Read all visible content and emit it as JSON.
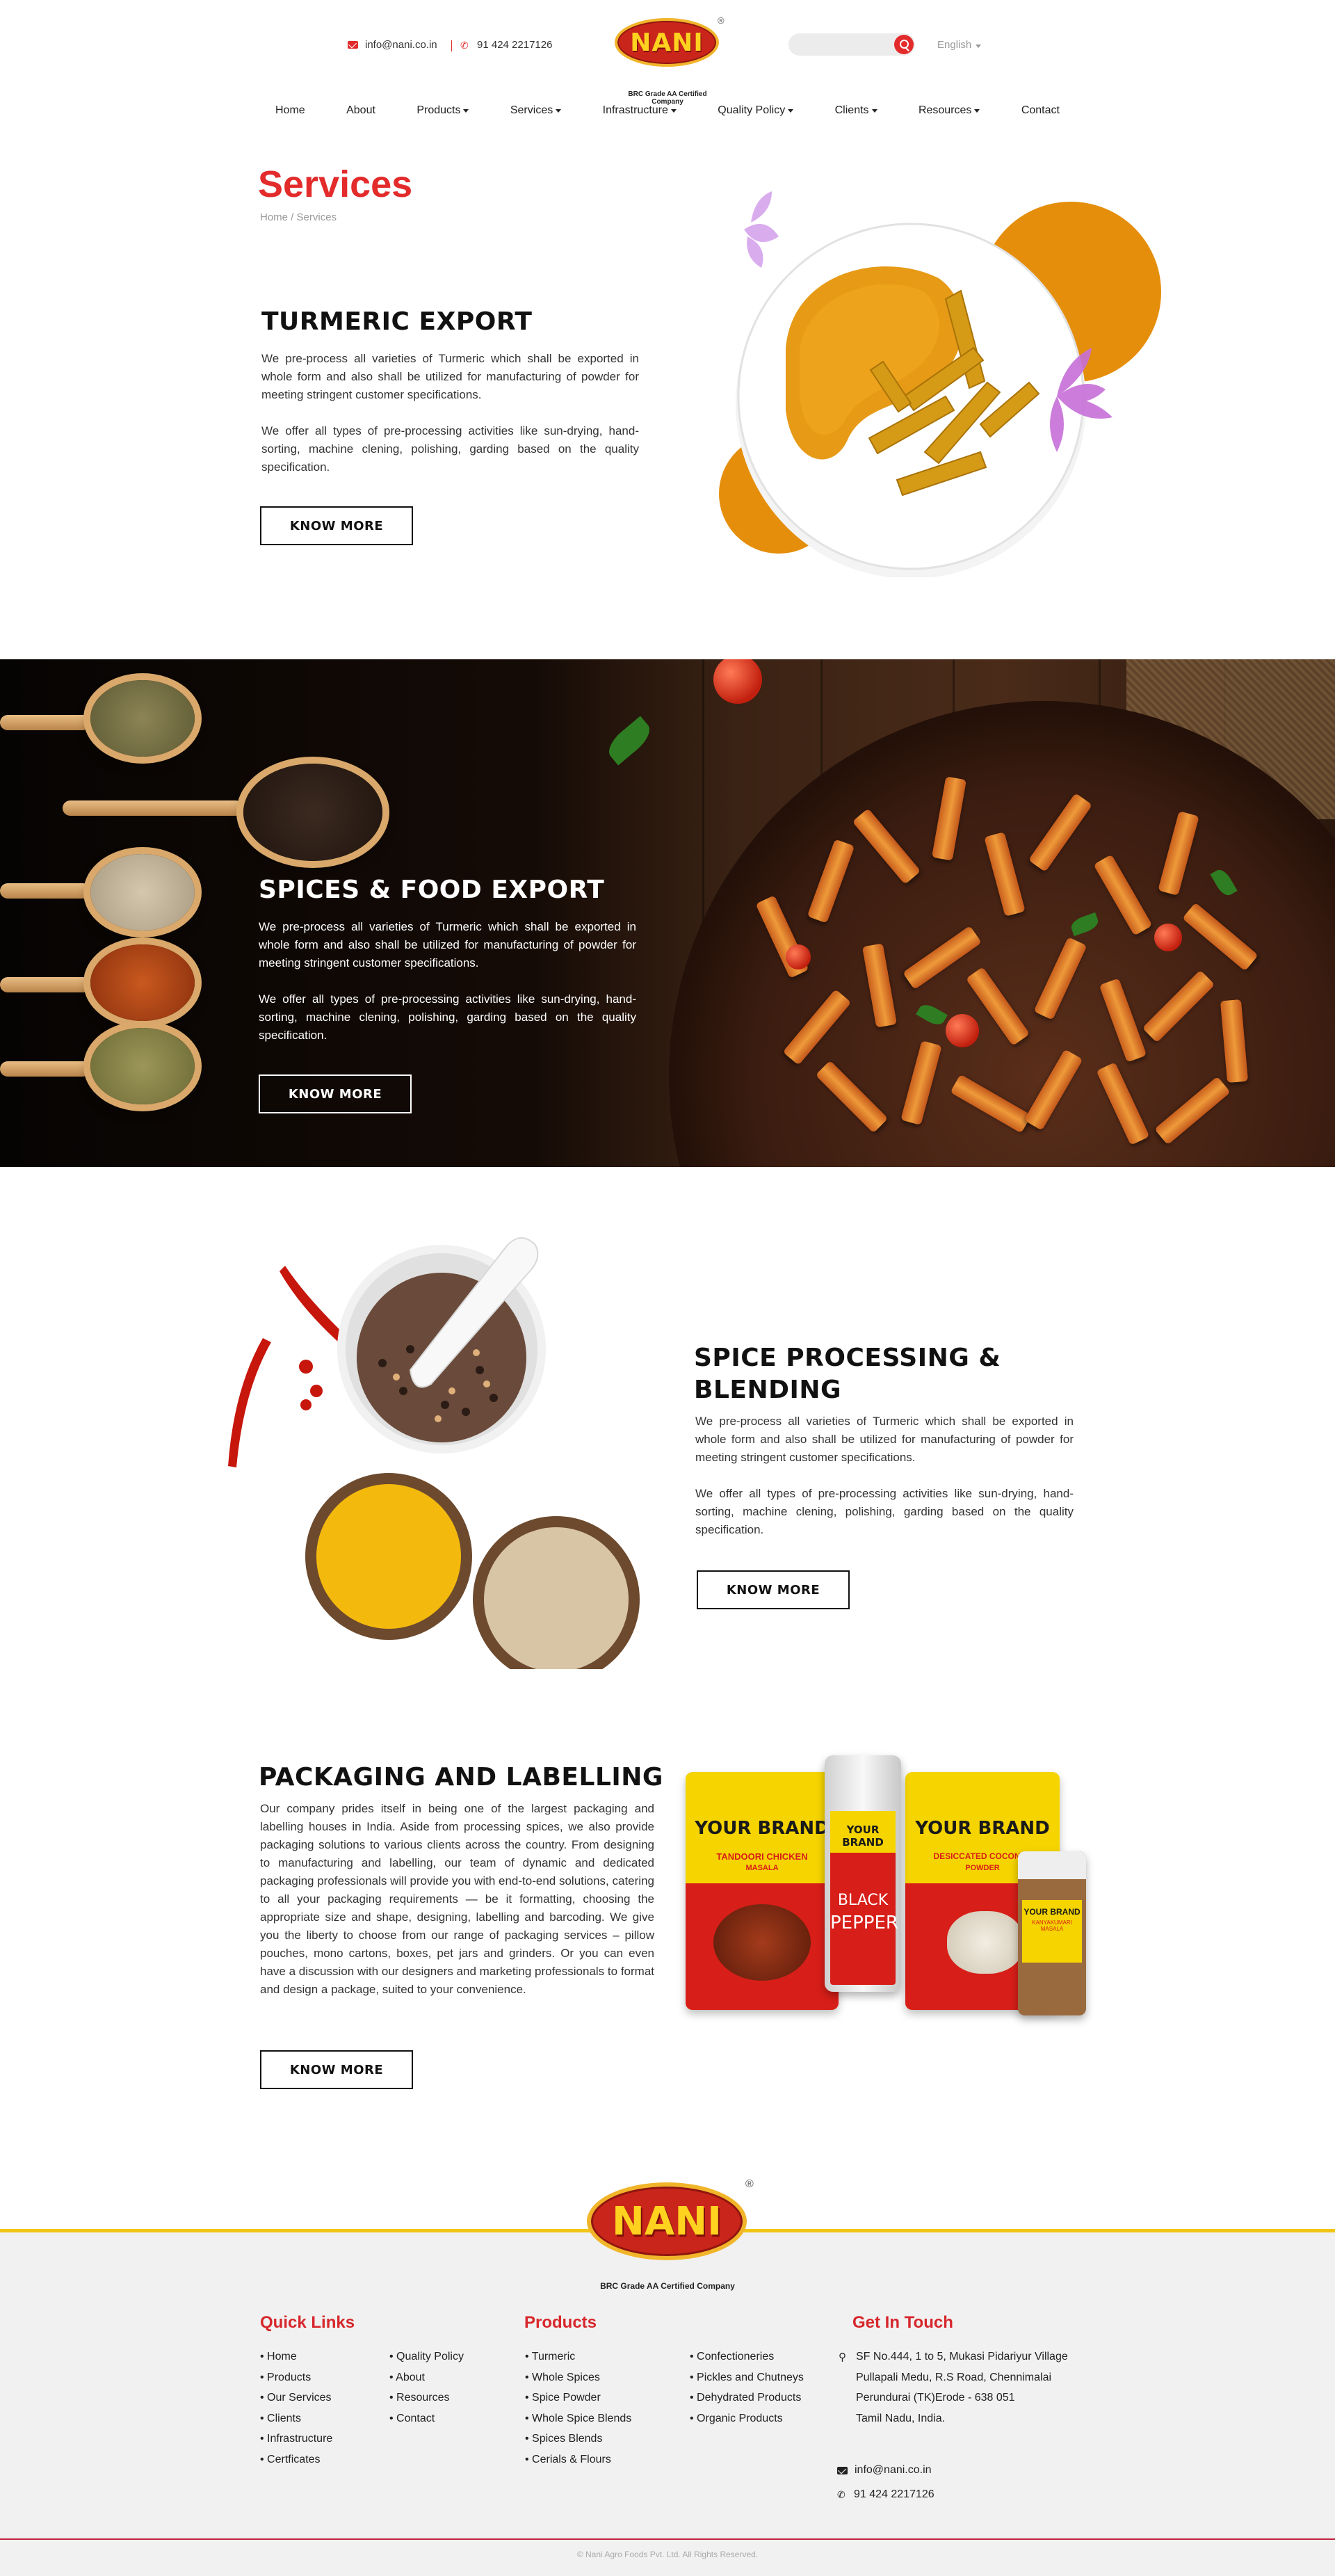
{
  "header": {
    "email": "info@nani.co.in",
    "phone": "91 424 2217126",
    "logo_text": "NANI",
    "logo_reg": "®",
    "logo_tagline": "BRC Grade AA Certified Company",
    "search_placeholder": "",
    "language": "English",
    "nav": [
      {
        "label": "Home",
        "dropdown": false
      },
      {
        "label": "About",
        "dropdown": false
      },
      {
        "label": "Products",
        "dropdown": true
      },
      {
        "label": "Services",
        "dropdown": true
      },
      {
        "label": "Infrastructure",
        "dropdown": true
      },
      {
        "label": "Quality Policy",
        "dropdown": true
      },
      {
        "label": "Clients",
        "dropdown": true
      },
      {
        "label": "Resources",
        "dropdown": true
      },
      {
        "label": "Contact",
        "dropdown": false
      }
    ]
  },
  "page": {
    "title": "Services",
    "breadcrumb": "Home / Services"
  },
  "sections": {
    "turmeric": {
      "heading": "TURMERIC EXPORT",
      "p1": "We pre-process all varieties of Turmeric which shall be exported in whole form and also shall be utilized for manufacturing of powder for meeting stringent customer specifications.",
      "p2": "We offer all types of pre-processing activities like sun-drying, hand-sorting, machine clening, polishing, garding based on the quality specification.",
      "button": "KNOW MORE"
    },
    "spices": {
      "heading": "SPICES & FOOD EXPORT",
      "p1": "We pre-process all varieties of Turmeric which shall be exported in whole form and also shall be utilized for manufacturing of powder for meeting stringent customer specifications.",
      "p2": "We offer all types of pre-processing activities like sun-drying, hand-sorting, machine clening, polishing, garding based on the quality specification.",
      "button": "KNOW MORE"
    },
    "processing": {
      "heading_line1": "SPICE PROCESSING &",
      "heading_line2": "BLENDING",
      "p1": "We pre-process all varieties of Turmeric which shall be exported in whole form and also shall be utilized for manufacturing of powder for meeting stringent customer specifications.",
      "p2": "We offer all types of pre-processing activities like sun-drying, hand-sorting, machine clening, polishing, garding based on the quality specification.",
      "button": "KNOW MORE"
    },
    "packaging": {
      "heading": "PACKAGING AND LABELLING",
      "p1": "Our company prides itself in being one of the largest packaging and labelling houses in India. Aside from processing spices, we also provide packaging solutions to various clients across the country. From designing to manufacturing and labelling, our team of dynamic and dedicated packaging professionals will provide you with end-to-end solutions, catering to all your packaging requirements — be it formatting, choosing the appropriate size and shape, designing, labelling and barcoding. We give you the liberty to choose from our range of packaging services – pillow pouches, mono cartons, boxes, pet jars and grinders. Or you can even have a discussion with our designers and marketing professionals to format and design a package, suited to your convenience.",
      "button": "KNOW MORE",
      "pack1_brand": "YOUR BRAND",
      "pack1_product": "TANDOORI CHICKEN",
      "pack1_sub": "MASALA",
      "jar_brand": "YOUR BRAND",
      "jar_product1": "BLACK",
      "jar_product2": "PEPPER",
      "pack2_brand": "YOUR BRAND",
      "pack2_product": "DESICCATED COCONUT",
      "pack2_sub": "POWDER",
      "small_brand": "YOUR BRAND",
      "small_product": "KANYAKUMARI MASALA"
    }
  },
  "footer": {
    "logo_text": "NANI",
    "logo_reg": "®",
    "logo_tagline": "BRC Grade AA Certified Company",
    "quick_links_title": "Quick Links",
    "quick_links_col1": [
      "Home",
      "Products",
      "Our Services",
      "Clients",
      "Infrastructure",
      "Certficates"
    ],
    "quick_links_col2": [
      "Quality Policy",
      "About",
      "Resources",
      "Contact"
    ],
    "products_title": "Products",
    "products_col1": [
      "Turmeric",
      "Whole Spices",
      "Spice Powder",
      "Whole Spice Blends",
      "Spices Blends",
      "Cerials & Flours"
    ],
    "products_col2": [
      "Confectioneries",
      "Pickles and Chutneys",
      "Dehydrated Products",
      "Organic Products"
    ],
    "contact_title": "Get In Touch",
    "address_lines": [
      "SF No.444, 1 to 5, Mukasi Pidariyur Village",
      "Pullapali Medu, R.S Road, Chennimalai",
      "Perundurai (TK)Erode - 638 051",
      "Tamil Nadu, India."
    ],
    "email": "info@nani.co.in",
    "phone": "91 424 2217126",
    "copyright": "© Nani Agro Foods Pvt. Ltd. All Rights Reserved."
  },
  "colors": {
    "accent_red": "#e32b2b",
    "footer_heading_red": "#d7272c",
    "footer_yellow": "#f2c514",
    "turmeric_orange": "#e58e0b"
  }
}
